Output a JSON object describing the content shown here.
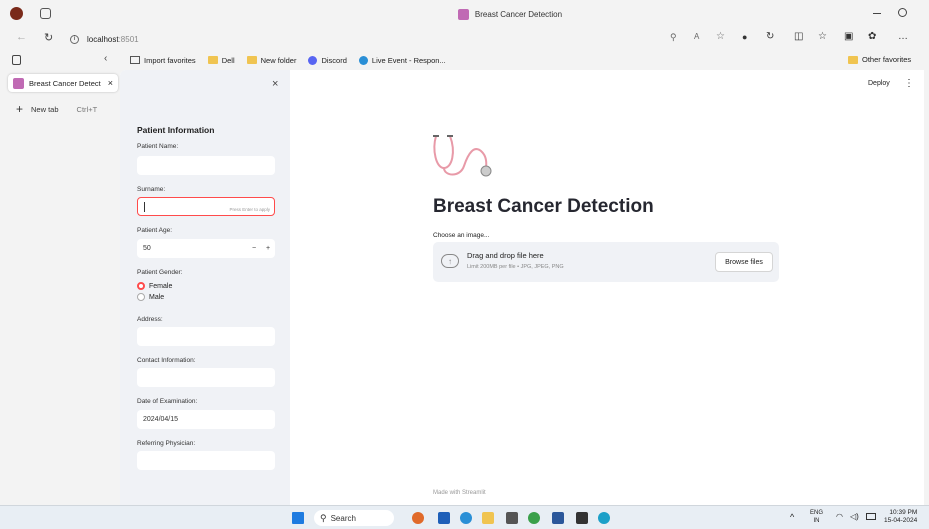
{
  "window": {
    "title": "Breast Cancer Detection"
  },
  "address": {
    "url_host": "localhost",
    "url_port": ":8501"
  },
  "favorites": [
    {
      "label": "Import favorites"
    },
    {
      "label": "Dell"
    },
    {
      "label": "New folder"
    },
    {
      "label": "Discord"
    },
    {
      "label": "Live Event - Respon..."
    }
  ],
  "other_favorites": "Other favorites",
  "tabs": {
    "active_label": "Breast Cancer Detect",
    "new_tab": "New tab",
    "new_tab_shortcut": "Ctrl+T"
  },
  "header": {
    "deploy": "Deploy"
  },
  "sidebar": {
    "heading": "Patient Information",
    "patient_name_label": "Patient Name:",
    "patient_name_value": "",
    "surname_label": "Surname:",
    "surname_value": "",
    "surname_hint": "Press Enter to apply",
    "age_label": "Patient Age:",
    "age_value": "50",
    "age_minus": "−",
    "age_plus": "+",
    "gender_label": "Patient Gender:",
    "gender_options": [
      "Female",
      "Male"
    ],
    "gender_selected": "Female",
    "address_label": "Address:",
    "address_value": "",
    "contact_label": "Contact Information:",
    "contact_value": "",
    "exam_date_label": "Date of Examination:",
    "exam_date_value": "2024/04/15",
    "physician_label": "Referring Physician:",
    "physician_value": ""
  },
  "main": {
    "title": "Breast Cancer Detection",
    "choose_label": "Choose an image...",
    "drop_title": "Drag and drop file here",
    "drop_limit": "Limit 200MB per file • JPG, JPEG, PNG",
    "browse_label": "Browse files",
    "footer": "Made with Streamlit"
  },
  "taskbar": {
    "search_label": "Search",
    "lang": "ENG",
    "lang_sub": "IN",
    "time": "10:39 PM",
    "date": "15-04-2024"
  },
  "colors": {
    "accent": "#ff4b4b",
    "sidebar_bg": "#f0f2f6"
  }
}
